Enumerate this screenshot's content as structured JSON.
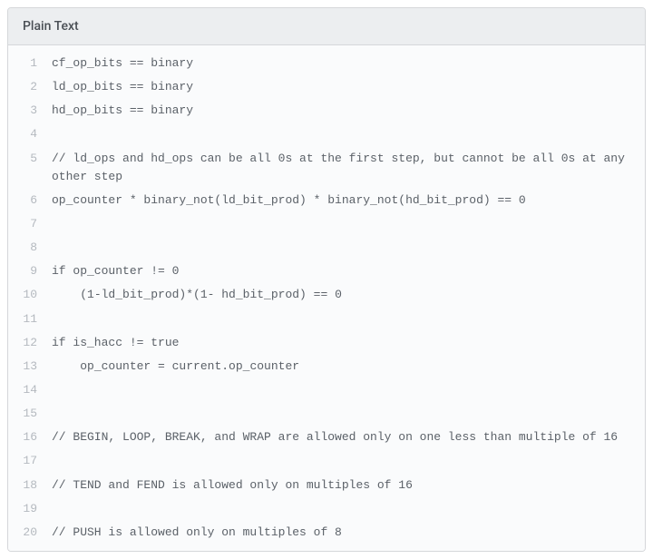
{
  "header": {
    "title": "Plain Text"
  },
  "lines": [
    {
      "n": "1",
      "text": "cf_op_bits == binary"
    },
    {
      "n": "2",
      "text": "ld_op_bits == binary"
    },
    {
      "n": "3",
      "text": "hd_op_bits == binary"
    },
    {
      "n": "4",
      "text": ""
    },
    {
      "n": "5",
      "text": "// ld_ops and hd_ops can be all 0s at the first step, but cannot be all 0s at any other step"
    },
    {
      "n": "6",
      "text": "op_counter * binary_not(ld_bit_prod) * binary_not(hd_bit_prod) == 0"
    },
    {
      "n": "7",
      "text": ""
    },
    {
      "n": "8",
      "text": ""
    },
    {
      "n": "9",
      "text": "if op_counter != 0"
    },
    {
      "n": "10",
      "text": "    (1-ld_bit_prod)*(1- hd_bit_prod) == 0"
    },
    {
      "n": "11",
      "text": ""
    },
    {
      "n": "12",
      "text": "if is_hacc != true"
    },
    {
      "n": "13",
      "text": "    op_counter = current.op_counter"
    },
    {
      "n": "14",
      "text": ""
    },
    {
      "n": "15",
      "text": ""
    },
    {
      "n": "16",
      "text": "// BEGIN, LOOP, BREAK, and WRAP are allowed only on one less than multiple of 16"
    },
    {
      "n": "17",
      "text": ""
    },
    {
      "n": "18",
      "text": "// TEND and FEND is allowed only on multiples of 16"
    },
    {
      "n": "19",
      "text": ""
    },
    {
      "n": "20",
      "text": "// PUSH is allowed only on multiples of 8"
    }
  ]
}
